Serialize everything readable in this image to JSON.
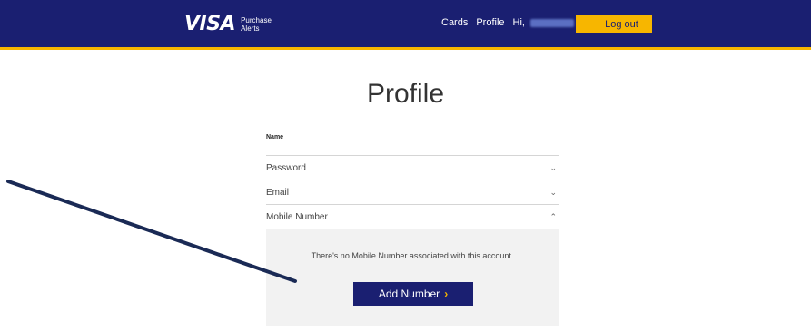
{
  "header": {
    "logo_text": "VISA",
    "logo_subtitle_line1": "Purchase",
    "logo_subtitle_line2": "Alerts",
    "nav_cards": "Cards",
    "nav_profile": "Profile",
    "greeting": "Hi,",
    "logout_label": "Log out"
  },
  "page": {
    "title": "Profile"
  },
  "form": {
    "name_label": "Name",
    "sections": [
      {
        "label": "Password",
        "chevron": "chevron-down"
      },
      {
        "label": "Email",
        "chevron": "chevron-down"
      },
      {
        "label": "Mobile Number",
        "chevron": "chevron-up"
      }
    ],
    "mobile_panel": {
      "message": "There's no Mobile Number associated with this account.",
      "add_button_label": "Add Number",
      "add_button_arrow": "›"
    }
  },
  "colors": {
    "brand_blue": "#1a1f71",
    "brand_gold": "#f7b600",
    "annotation_line": "#1a2a55"
  },
  "icons": {
    "down": "⌄",
    "up": "⌃"
  }
}
